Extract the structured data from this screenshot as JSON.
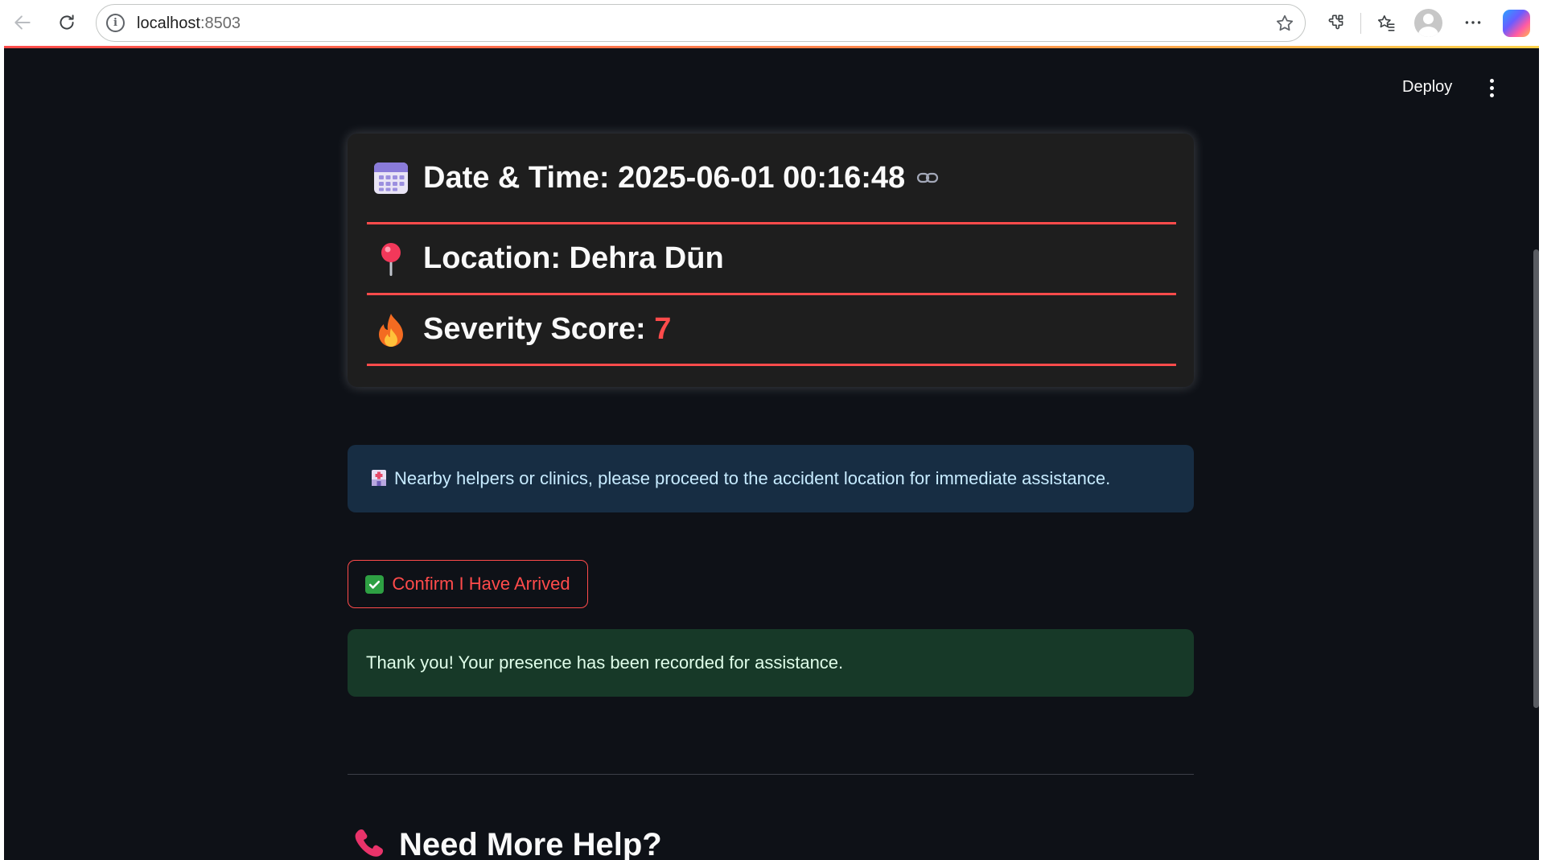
{
  "browser": {
    "url_host": "localhost",
    "url_port": ":8503"
  },
  "header": {
    "deploy_label": "Deploy"
  },
  "incident": {
    "datetime_label": "Date & Time: 2025-06-01 00:16:48",
    "location_label": "Location: Dehra Dūn",
    "severity_label": "Severity Score: ",
    "severity_value": "7"
  },
  "info_alert": {
    "icon": "hospital-icon",
    "text": "Nearby helpers or clinics, please proceed to the accident location for immediate assistance."
  },
  "confirm_button": {
    "icon": "check-mark-icon",
    "label": "Confirm I Have Arrived"
  },
  "success_alert": {
    "text": "Thank you! Your presence has been recorded for assistance."
  },
  "help_section": {
    "icon": "phone-icon",
    "heading": "Need More Help?"
  },
  "colors": {
    "app_background": "#0e1117",
    "card_background": "#1e1e1e",
    "accent_red": "#ff4b4b",
    "info_background": "#172d43",
    "success_background": "#173928"
  }
}
